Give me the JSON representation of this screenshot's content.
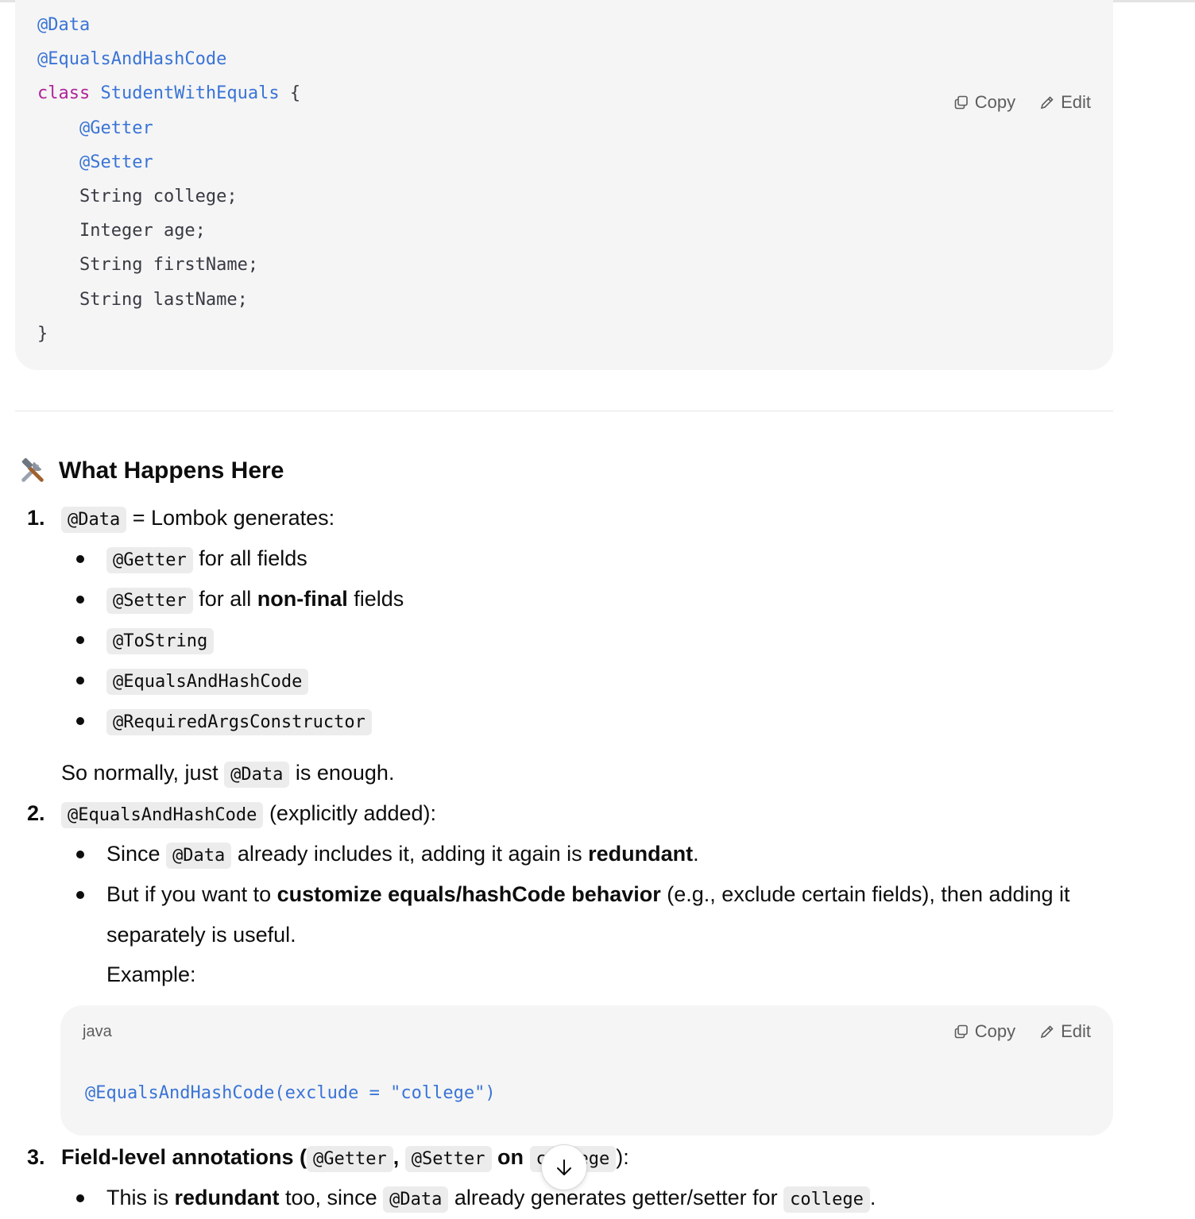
{
  "code_block_1": {
    "lines": [
      "@Data",
      "@EqualsAndHashCode",
      "class ",
      "StudentWithEquals",
      " {",
      "@Getter",
      "@Setter",
      "String college;",
      "Integer age;",
      "String firstName;",
      "String lastName;",
      "}"
    ],
    "copy_label": "Copy",
    "edit_label": "Edit"
  },
  "section": {
    "icon": "hammer-and-wrench-icon",
    "title": "What Happens Here"
  },
  "item1": {
    "number": "1.",
    "code": "@Data",
    "text": "= Lombok generates:",
    "bullets": [
      {
        "code": "@Getter",
        "text": "for all fields"
      },
      {
        "code": "@Setter",
        "text_pre": "for all ",
        "bold": "non-final",
        "text_post": " fields"
      },
      {
        "code": "@ToString"
      },
      {
        "code": "@EqualsAndHashCode"
      },
      {
        "code": "@RequiredArgsConstructor"
      }
    ],
    "note_pre": "So normally, just",
    "note_code": "@Data",
    "note_post": "is enough."
  },
  "item2": {
    "number": "2.",
    "code": "@EqualsAndHashCode",
    "text": "(explicitly added):",
    "b1_pre": "Since",
    "b1_code": "@Data",
    "b1_mid": "already includes it, adding it again is ",
    "b1_bold": "redundant",
    "b1_post": ".",
    "b2_pre": "But if you want to ",
    "b2_bold": "customize equals/hashCode behavior",
    "b2_post": " (e.g., exclude certain fields), then adding it",
    "b2_cont": "separately is useful.",
    "example": "Example:"
  },
  "code_block_2": {
    "language": "java",
    "copy_label": "Copy",
    "edit_label": "Edit",
    "code": "@EqualsAndHashCode(exclude = \"college\")"
  },
  "item3": {
    "number": "3.",
    "bold": "Field-level annotations (",
    "code1": "@Getter",
    "sep": ",",
    "code2": "@Setter",
    "on": "on",
    "code3": "college",
    "post": "):",
    "b1_pre": "This is ",
    "b1_bold": "redundant",
    "b1_mid": " too, since",
    "b1_code": "@Data",
    "b1_mid2": "already generates getter/setter for",
    "b1_code2": "college",
    "b1_post": "."
  }
}
